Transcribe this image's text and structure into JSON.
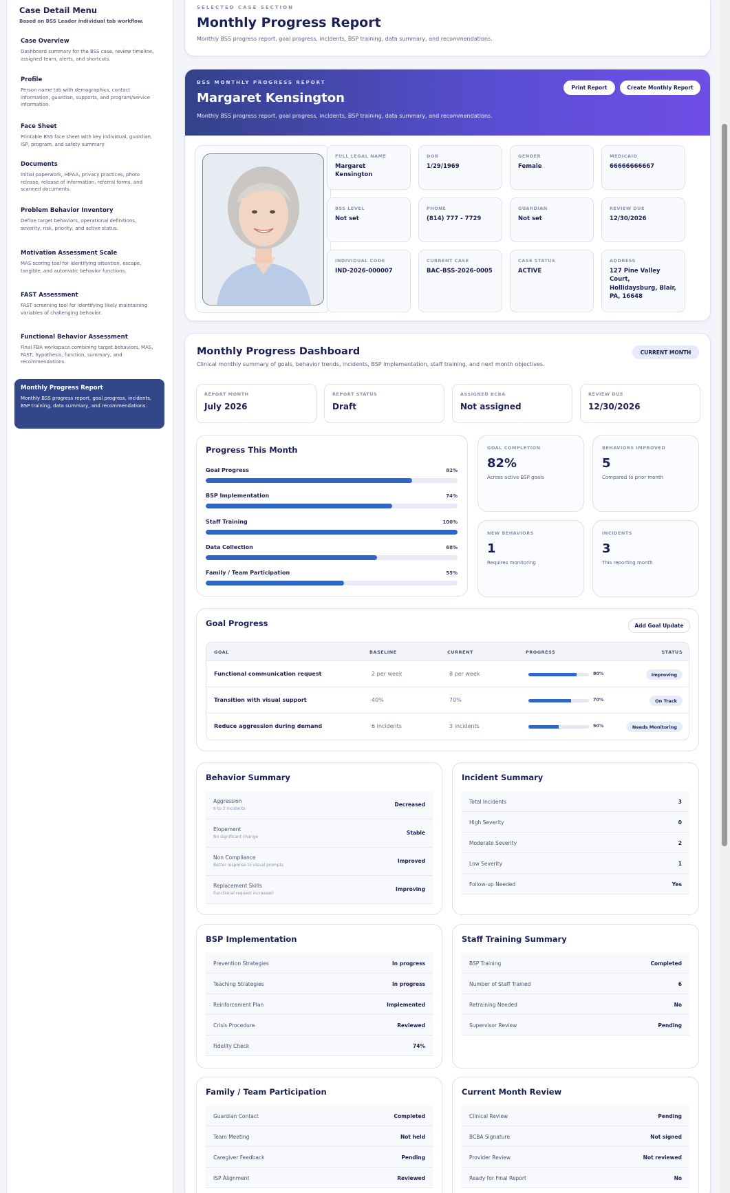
{
  "sidebar": {
    "title": "Case Detail Menu",
    "subtitle": "Based on BSS Leader individual tab workflow.",
    "items": [
      {
        "label": "Case Overview",
        "desc": "Dashboard summary for the BSS case, review timeline, assigned team, alerts, and shortcuts."
      },
      {
        "label": "Profile",
        "desc": "Person name tab with demographics, contact information, guardian, supports, and program/service information."
      },
      {
        "label": "Face Sheet",
        "desc": "Printable BSS face sheet with key individual, guardian, ISP, program, and safety summary."
      },
      {
        "label": "Documents",
        "desc": "Initial paperwork, HIPAA, privacy practices, photo release, release of information, referral forms, and scanned documents."
      },
      {
        "label": "Problem Behavior Inventory",
        "desc": "Define target behaviors, operational definitions, severity, risk, priority, and active status."
      },
      {
        "label": "Motivation Assessment Scale",
        "desc": "MAS scoring tool for identifying attention, escape, tangible, and automatic behavior functions."
      },
      {
        "label": "FAST Assessment",
        "desc": "FAST screening tool for identifying likely maintaining variables of challenging behavior."
      },
      {
        "label": "Functional Behavior Assessment",
        "desc": "Final FBA workspace combining target behaviors, MAS, FAST, hypothesis, function, summary, and recommendations."
      },
      {
        "label": "Monthly Progress Report",
        "desc": "Monthly BSS progress report, goal progress, incidents, BSP training, data summary, and recommendations."
      }
    ]
  },
  "section": {
    "eyebrow": "SELECTED CASE SECTION",
    "title": "Monthly Progress Report",
    "desc": "Monthly BSS progress report, goal progress, incidents, BSP training, data summary, and recommendations."
  },
  "banner": {
    "eyebrow": "BSS MONTHLY PROGRESS REPORT",
    "name": "Margaret Kensington",
    "desc": "Monthly BSS progress report, goal progress, incidents, BSP training, data summary, and recommendations.",
    "print": "Print Report",
    "create": "Create Monthly Report"
  },
  "fields": [
    {
      "label": "FULL LEGAL NAME",
      "value": "Margaret Kensington"
    },
    {
      "label": "DOB",
      "value": "1/29/1969"
    },
    {
      "label": "GENDER",
      "value": "Female"
    },
    {
      "label": "MEDICAID",
      "value": "66666666667"
    },
    {
      "label": "BSS LEVEL",
      "value": "Not set"
    },
    {
      "label": "PHONE",
      "value": "(814) 777 - 7729"
    },
    {
      "label": "GUARDIAN",
      "value": "Not set"
    },
    {
      "label": "REVIEW DUE",
      "value": "12/30/2026"
    },
    {
      "label": "INDIVIDUAL CODE",
      "value": "IND-2026-000007"
    },
    {
      "label": "CURRENT CASE",
      "value": "BAC-BSS-2026-0005"
    },
    {
      "label": "CASE STATUS",
      "value": "ACTIVE"
    },
    {
      "label": "ADDRESS",
      "value": "127 Pine Valley Court, Hollidaysburg, Blair, PA, 16648"
    }
  ],
  "dashboard": {
    "title": "Monthly Progress Dashboard",
    "desc": "Clinical monthly summary of goals, behavior trends, incidents, BSP implementation, staff training, and next month objectives.",
    "pill": "CURRENT MONTH",
    "kpis": [
      {
        "label": "REPORT MONTH",
        "value": "July 2026"
      },
      {
        "label": "REPORT STATUS",
        "value": "Draft"
      },
      {
        "label": "ASSIGNED BCBA",
        "value": "Not assigned"
      },
      {
        "label": "REVIEW DUE",
        "value": "12/30/2026"
      }
    ],
    "progress": {
      "title": "Progress This Month",
      "rows": [
        {
          "label": "Goal Progress",
          "pct": "82%",
          "value": 82
        },
        {
          "label": "BSP Implementation",
          "pct": "74%",
          "value": 74
        },
        {
          "label": "Staff Training",
          "pct": "100%",
          "value": 100
        },
        {
          "label": "Data Collection",
          "pct": "68%",
          "value": 68
        },
        {
          "label": "Family / Team Participation",
          "pct": "55%",
          "value": 55
        }
      ]
    },
    "stats": [
      {
        "label": "GOAL COMPLETION",
        "value": "82%",
        "sub": "Across active BSP goals"
      },
      {
        "label": "BEHAVIORS IMPROVED",
        "value": "5",
        "sub": "Compared to prior month"
      },
      {
        "label": "NEW BEHAVIORS",
        "value": "1",
        "sub": "Requires monitoring"
      },
      {
        "label": "INCIDENTS",
        "value": "3",
        "sub": "This reporting month"
      }
    ]
  },
  "goals": {
    "title": "Goal Progress",
    "add": "Add Goal Update",
    "headers": [
      "GOAL",
      "BASELINE",
      "CURRENT",
      "PROGRESS",
      "STATUS"
    ],
    "rows": [
      {
        "goal": "Functional communication request",
        "baseline": "2 per week",
        "current": "8 per week",
        "pct": "80%",
        "value": 80,
        "status": "Improving"
      },
      {
        "goal": "Transition with visual support",
        "baseline": "40%",
        "current": "70%",
        "pct": "70%",
        "value": 70,
        "status": "On Track"
      },
      {
        "goal": "Reduce aggression during demand",
        "baseline": "6 incidents",
        "current": "3 incidents",
        "pct": "50%",
        "value": 50,
        "status": "Needs Monitoring"
      }
    ]
  },
  "behavior": {
    "title": "Behavior Summary",
    "rows": [
      {
        "k": "Aggression",
        "sub": "6 to 3 incidents",
        "v": "Decreased"
      },
      {
        "k": "Elopement",
        "sub": "No significant change",
        "v": "Stable"
      },
      {
        "k": "Non Compliance",
        "sub": "Better response to visual prompts",
        "v": "Improved"
      },
      {
        "k": "Replacement Skills",
        "sub": "Functional request increased",
        "v": "Improving"
      }
    ]
  },
  "incident": {
    "title": "Incident Summary",
    "rows": [
      {
        "k": "Total Incidents",
        "v": "3"
      },
      {
        "k": "High Severity",
        "v": "0"
      },
      {
        "k": "Moderate Severity",
        "v": "2"
      },
      {
        "k": "Low Severity",
        "v": "1"
      },
      {
        "k": "Follow-up Needed",
        "v": "Yes"
      }
    ]
  },
  "bsp": {
    "title": "BSP Implementation",
    "rows": [
      {
        "k": "Prevention Strategies",
        "v": "In progress"
      },
      {
        "k": "Teaching Strategies",
        "v": "In progress"
      },
      {
        "k": "Reinforcement Plan",
        "v": "Implemented"
      },
      {
        "k": "Crisis Procedure",
        "v": "Reviewed"
      },
      {
        "k": "Fidelity Check",
        "v": "74%"
      }
    ]
  },
  "staff": {
    "title": "Staff Training Summary",
    "rows": [
      {
        "k": "BSP Training",
        "v": "Completed"
      },
      {
        "k": "Number of Staff Trained",
        "v": "6"
      },
      {
        "k": "Retraining Needed",
        "v": "No"
      },
      {
        "k": "Supervisor Review",
        "v": "Pending"
      }
    ]
  },
  "family": {
    "title": "Family / Team Participation",
    "rows": [
      {
        "k": "Guardian Contact",
        "v": "Completed"
      },
      {
        "k": "Team Meeting",
        "v": "Not held"
      },
      {
        "k": "Caregiver Feedback",
        "v": "Pending"
      },
      {
        "k": "ISP Alignment",
        "v": "Reviewed"
      }
    ]
  },
  "review": {
    "title": "Current Month Review",
    "rows": [
      {
        "k": "Clinical Review",
        "v": "Pending"
      },
      {
        "k": "BCBA Signature",
        "v": "Not signed"
      },
      {
        "k": "Provider Review",
        "v": "Not reviewed"
      },
      {
        "k": "Ready for Final Report",
        "v": "No"
      }
    ]
  }
}
